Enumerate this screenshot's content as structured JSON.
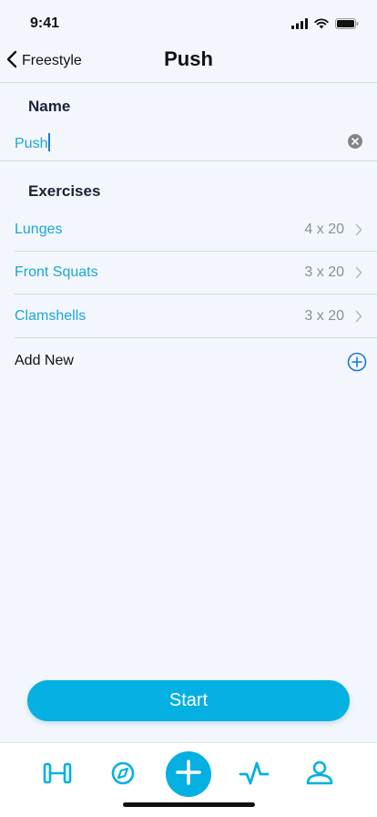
{
  "status_bar": {
    "time": "9:41"
  },
  "nav": {
    "back_label": "Freestyle",
    "title": "Push"
  },
  "name_section": {
    "header": "Name",
    "value": "Push"
  },
  "exercises_section": {
    "header": "Exercises",
    "items": [
      {
        "name": "Lunges",
        "sets": "4 x 20"
      },
      {
        "name": "Front Squats",
        "sets": "3 x 20"
      },
      {
        "name": "Clamshells",
        "sets": "3 x 20"
      }
    ],
    "add_label": "Add New"
  },
  "start_button": {
    "label": "Start"
  },
  "tab_bar": {
    "icons": [
      "dumbbell-icon",
      "compass-icon",
      "plus-icon",
      "activity-icon",
      "profile-icon"
    ]
  },
  "colors": {
    "accent": "#04b0e1",
    "link_text": "#1aa6d6",
    "add_icon": "#1877e0",
    "background": "#f3f7fd"
  }
}
